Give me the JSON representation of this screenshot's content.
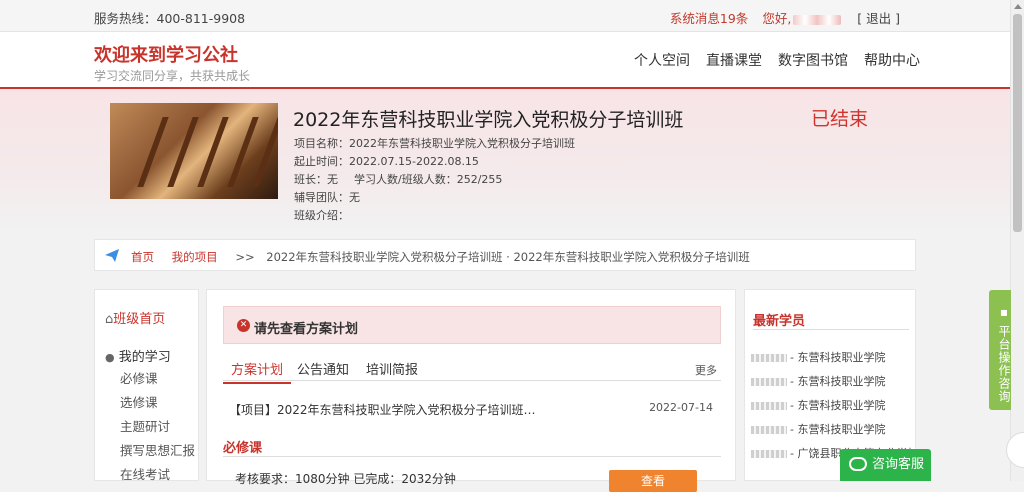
{
  "topbar": {
    "hotline_label": "服务热线：400-811-9908",
    "messages": "系统消息19条",
    "greeting": "您好,",
    "logout": "[ 退出 ]"
  },
  "brand": {
    "title": "欢迎来到学习公社",
    "subtitle": "学习交流同分享，共获共成长"
  },
  "nav": [
    "个人空间",
    "直播课堂",
    "数字图书馆",
    "帮助中心"
  ],
  "course": {
    "title": "2022年东营科技职业学院入党积极分子培训班",
    "status": "已结束",
    "project_name": "项目名称：2022年东营科技职业学院入党积极分子培训班",
    "period": "起止时间：2022.07.15-2022.08.15",
    "monitor": "班长：无",
    "counts": "学习人数/班级人数：252/255",
    "tutors": "辅导团队：无",
    "intro": "班级介绍："
  },
  "breadcrumb": {
    "home": "首页",
    "my_projects": "我的项目",
    "sep": ">>",
    "current": "2022年东营科技职业学院入党积极分子培训班 · 2022年东营科技职业学院入党积极分子培训班"
  },
  "sidebar": {
    "home": "班级首页",
    "my_study": "我的学习",
    "items": [
      "必修课",
      "选修课",
      "主题研讨",
      "撰写思想汇报",
      "在线考试"
    ]
  },
  "main": {
    "alert": "请先查看方案计划",
    "tabs": [
      "方案计划",
      "公告通知",
      "培训简报"
    ],
    "more": "更多",
    "item_title": "【项目】2022年东营科技职业学院入党积极分子培训班…",
    "item_date": "2022-07-14",
    "required_heading": "必修课",
    "requirement": "考核要求：1080分钟 已完成：2032分钟",
    "view_button": "查看"
  },
  "students": {
    "title": "最新学员",
    "list": [
      "- 东营科技职业学院",
      "- 东营科技职业学院",
      "- 东营科技职业学院",
      "- 东营科技职业学院",
      "- 广饶县职业中等专业学校"
    ]
  },
  "side_consult": "平台操作咨询",
  "chat": "咨询客服",
  "colors": {
    "accent": "#c8342c",
    "button": "#f0832e",
    "chat": "#2cb34a",
    "side": "#8cc152"
  }
}
